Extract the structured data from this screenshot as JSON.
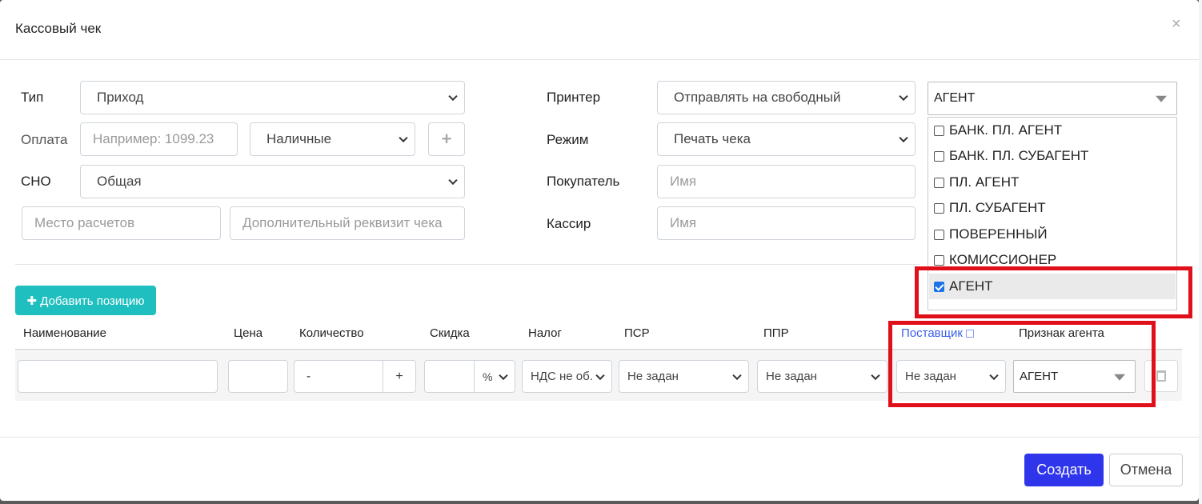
{
  "dialog": {
    "title": "Кассовый чек",
    "close_glyph": "×"
  },
  "form": {
    "type_label": "Тип",
    "type_value": "Приход",
    "payment_label": "Оплата",
    "payment_placeholder": "Например: 1099.23",
    "payment_method": "Наличные",
    "add_payment_glyph": "+",
    "sno_label": "СНО",
    "sno_value": "Общая",
    "place_placeholder": "Место расчетов",
    "extra_placeholder": "Дополнительный реквизит чека",
    "printer_label": "Принтер",
    "printer_value": "Отправлять на свободный",
    "mode_label": "Режим",
    "mode_value": "Печать чека",
    "buyer_label": "Покупатель",
    "buyer_placeholder": "Имя",
    "cashier_label": "Кассир",
    "cashier_placeholder": "Имя",
    "agent_select_value": "АГЕНТ"
  },
  "agent_dropdown": {
    "options": [
      {
        "label": "БАНК. ПЛ. АГЕНТ",
        "checked": false
      },
      {
        "label": "БАНК. ПЛ. СУБАГЕНТ",
        "checked": false
      },
      {
        "label": "ПЛ. АГЕНТ",
        "checked": false
      },
      {
        "label": "ПЛ. СУБАГЕНТ",
        "checked": false
      },
      {
        "label": "ПОВЕРЕННЫЙ",
        "checked": false
      },
      {
        "label": "КОМИССИОНЕР",
        "checked": false
      },
      {
        "label": "АГЕНТ",
        "checked": true
      }
    ]
  },
  "items": {
    "add_button": "✚ Добавить позицию",
    "columns": [
      "Наименование",
      "Цена",
      "Количество",
      "Скидка",
      "Налог",
      "ПСР",
      "ППР",
      "Поставщик",
      "Признак агента"
    ],
    "row": {
      "qty_minus": "-",
      "qty_plus": "+",
      "discount_unit": "%",
      "tax": "НДС не об.",
      "psr": "Не задан",
      "ppr": "Не задан",
      "supplier": "Не задан",
      "agent_sign": "АГЕНТ"
    }
  },
  "footer": {
    "create": "Создать",
    "cancel": "Отмена"
  },
  "colors": {
    "accent": "#2e35ea",
    "teal": "#1fbfbf",
    "highlight": "#e0101a"
  }
}
